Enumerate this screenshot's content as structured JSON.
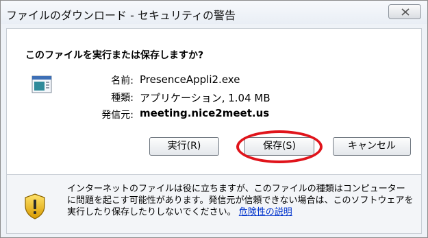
{
  "window": {
    "title": "ファイルのダウンロード - セキュリティの警告",
    "close_icon": "close-x-icon"
  },
  "dialog": {
    "question": "このファイルを実行または保存しますか?",
    "file_icon": "executable-file-icon",
    "fields": {
      "name_label": "名前:",
      "name_value": "PresenceAppli2.exe",
      "type_label": "種類:",
      "type_value": "アプリケーション, 1.04 MB",
      "from_label": "発信元:",
      "from_value": "meeting.nice2meet.us"
    },
    "buttons": {
      "run": "実行(R)",
      "save": "保存(S)",
      "cancel": "キャンセル"
    },
    "highlight_color": "#e0141b"
  },
  "warning": {
    "icon": "shield-warning-icon",
    "text": "インターネットのファイルは役に立ちますが、このファイルの種類はコンピューターに問題を起こす可能性があります。発信元が信頼できない場合は、このソフトウェアを実行したり保存したりしないでください。",
    "link": "危険性の説明"
  }
}
